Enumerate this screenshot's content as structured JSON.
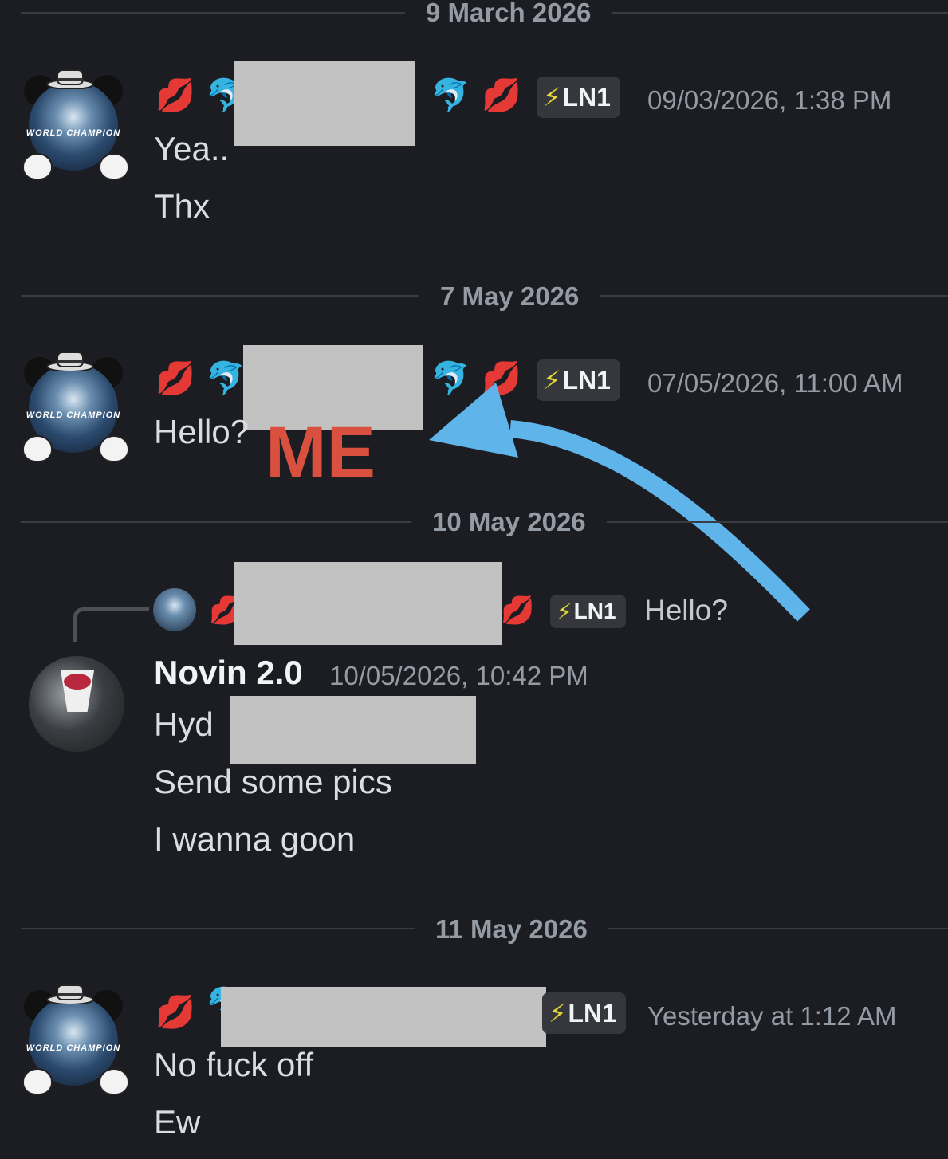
{
  "dates": [
    "9 March 2026",
    "7 May 2026",
    "10 May 2026",
    "11 May 2026"
  ],
  "messages": [
    {
      "tag": "LN1",
      "time": "09/03/2026, 1:38 PM",
      "lines": [
        "Yea..",
        "Thx"
      ]
    },
    {
      "tag": "LN1",
      "time": "07/05/2026, 11:00 AM",
      "lines": [
        "Hello?"
      ]
    },
    {
      "reply": {
        "tag": "LN1",
        "text": "Hello?"
      },
      "author": "Novin 2.0",
      "time": "10/05/2026, 10:42 PM",
      "lines": [
        "Hyd",
        "Send some pics",
        "I wanna goon"
      ]
    },
    {
      "tag": "LN1",
      "time": "Yesterday at 1:12 AM",
      "lines": [
        "No fuck off",
        "Ew"
      ]
    }
  ],
  "annotation": {
    "label": "ME",
    "label_color": "#d9503f",
    "arrow_color": "#5fb4ea"
  },
  "icons": {
    "lips": "💋",
    "dolphin": "🐬",
    "bolt": "⚡"
  },
  "avatar_text": {
    "big": "WORLD CHAMPION"
  },
  "colors": {
    "background": "#1c1d22",
    "timestamp": "#949ba4",
    "tag_bg": "#35373c"
  }
}
